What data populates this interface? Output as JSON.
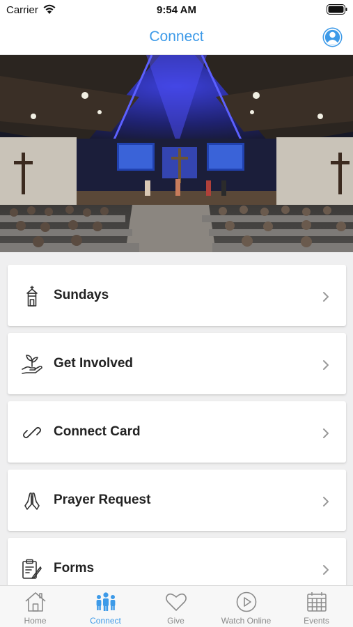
{
  "status": {
    "carrier": "Carrier",
    "time": "9:54 AM"
  },
  "nav": {
    "title": "Connect",
    "accent": "#3d9ae8"
  },
  "hero": {
    "description_icon": "church-sanctuary-photo"
  },
  "menu": {
    "items": [
      {
        "label": "Sundays",
        "icon": "steeple-icon"
      },
      {
        "label": "Get Involved",
        "icon": "hand-plant-icon"
      },
      {
        "label": "Connect Card",
        "icon": "link-icon"
      },
      {
        "label": "Prayer Request",
        "icon": "praying-hands-icon"
      },
      {
        "label": "Forms",
        "icon": "clipboard-icon"
      }
    ]
  },
  "tabs": {
    "items": [
      {
        "label": "Home",
        "icon": "home-icon"
      },
      {
        "label": "Connect",
        "icon": "people-icon",
        "active": true
      },
      {
        "label": "Give",
        "icon": "heart-icon"
      },
      {
        "label": "Watch Online",
        "icon": "play-icon"
      },
      {
        "label": "Events",
        "icon": "calendar-icon"
      }
    ]
  }
}
